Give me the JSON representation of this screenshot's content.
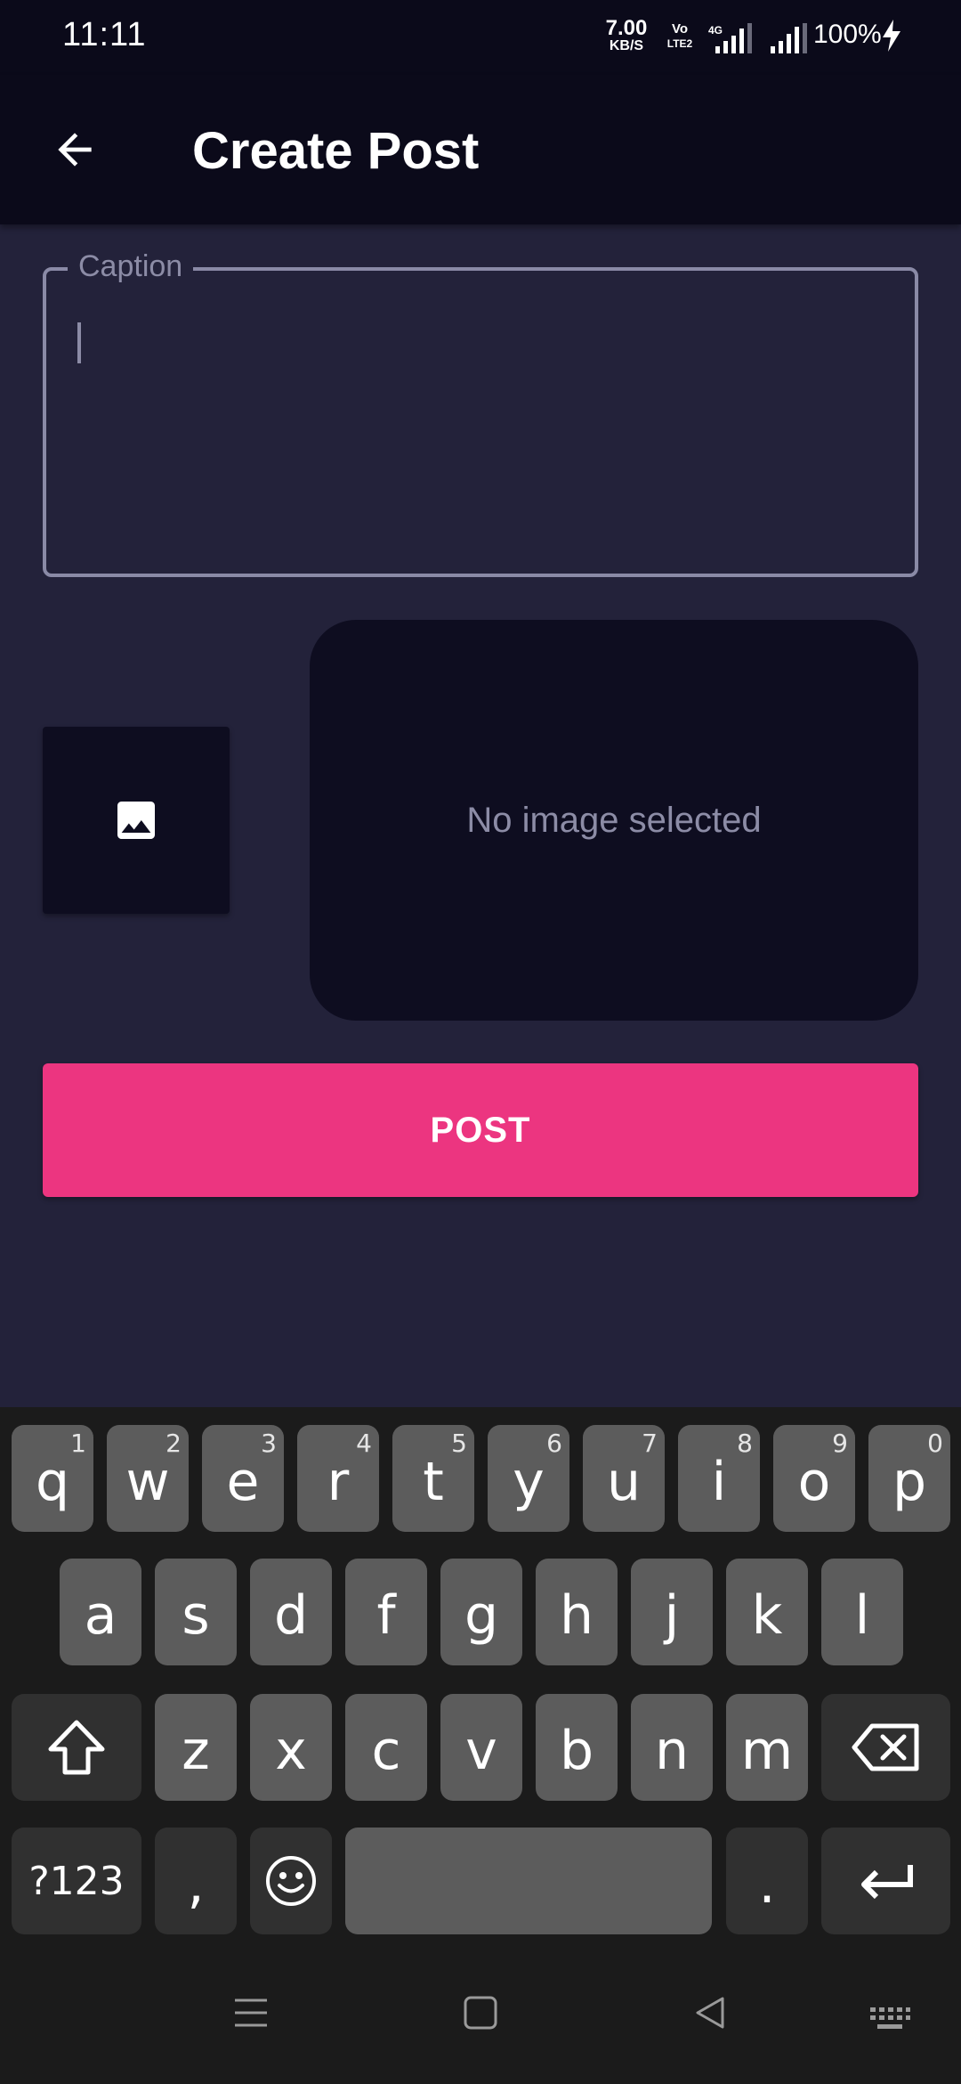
{
  "status_bar": {
    "time": "11:11",
    "net_speed_value": "7.00",
    "net_speed_unit": "KB/S",
    "volte_top": "Vo",
    "volte_bottom": "LTE2",
    "network_type": "4G",
    "battery": "100%"
  },
  "app_bar": {
    "title": "Create Post"
  },
  "caption": {
    "label": "Caption",
    "value": ""
  },
  "image_picker": {
    "empty_text": "No image selected"
  },
  "post_button": {
    "label": "POST"
  },
  "keyboard": {
    "row1": [
      {
        "char": "q",
        "hint": "1"
      },
      {
        "char": "w",
        "hint": "2"
      },
      {
        "char": "e",
        "hint": "3"
      },
      {
        "char": "r",
        "hint": "4"
      },
      {
        "char": "t",
        "hint": "5"
      },
      {
        "char": "y",
        "hint": "6"
      },
      {
        "char": "u",
        "hint": "7"
      },
      {
        "char": "i",
        "hint": "8"
      },
      {
        "char": "o",
        "hint": "9"
      },
      {
        "char": "p",
        "hint": "0"
      }
    ],
    "row2": [
      "a",
      "s",
      "d",
      "f",
      "g",
      "h",
      "j",
      "k",
      "l"
    ],
    "row3": [
      "z",
      "x",
      "c",
      "v",
      "b",
      "n",
      "m"
    ],
    "symbols_label": "?123",
    "comma": ",",
    "period": "."
  },
  "colors": {
    "background": "#23223a",
    "bar": "#0b0a1a",
    "accent": "#ec3580",
    "muted_text": "#8c8ca6"
  }
}
